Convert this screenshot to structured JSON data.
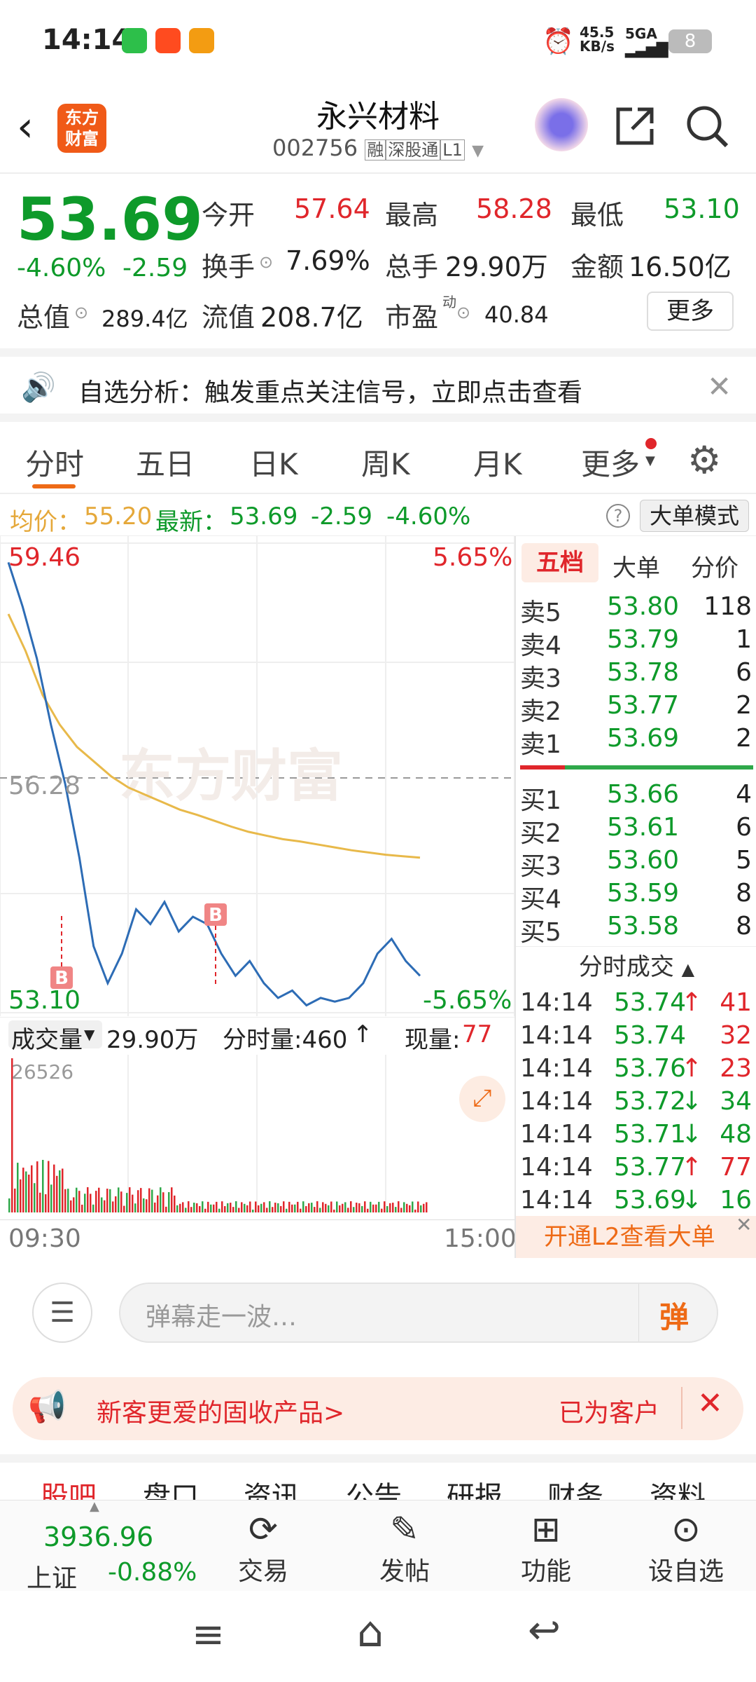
{
  "status_bar": {
    "time": "14:14",
    "net_speed_value": "45.5",
    "net_speed_unit": "KB/s",
    "network": "5GA",
    "battery": "8"
  },
  "header": {
    "title": "永兴材料",
    "code": "002756",
    "tags": [
      "融",
      "深股通",
      "L1"
    ],
    "logo_line1": "东方",
    "logo_line2": "财富"
  },
  "quote": {
    "price": "53.69",
    "change_pct": "-4.60%",
    "change": "-2.59",
    "open_label": "今开",
    "open": "57.64",
    "high_label": "最高",
    "high": "58.28",
    "low_label": "最低",
    "low": "53.10",
    "turnover_label": "换手",
    "turnover": "7.69%",
    "volume_label": "总手",
    "volume": "29.90万",
    "amount_label": "金额",
    "amount": "16.50亿",
    "mktcap_label": "总值",
    "mktcap": "289.4亿",
    "float_label": "流值",
    "float": "208.7亿",
    "pe_label": "市盈",
    "pe_sup": "动",
    "pe": "40.84",
    "more_label": "更多"
  },
  "banner": {
    "text": "自选分析：触发重点关注信号，立即点击查看"
  },
  "tabs": [
    "分时",
    "五日",
    "日K",
    "周K",
    "月K",
    "更多"
  ],
  "avg_line": {
    "avg_label": "均价：",
    "avg": "55.20",
    "last_label": "最新：",
    "last": "53.69",
    "change": "-2.59",
    "pct": "-4.60%",
    "mode_label": "大单模式"
  },
  "chart": {
    "y_max": "59.46",
    "y_max_pct": "5.65%",
    "y_mid": "56.28",
    "y_min": "53.10",
    "y_min_pct": "-5.65%",
    "watermark": "东方财富",
    "marker": "B",
    "vol_label": "成交量",
    "vol_total": "29.90万",
    "minute_vol_label": "分时量:460",
    "minute_vol_arrow": "↑",
    "current_vol_label": "现量:",
    "current_vol": "77",
    "vol_max": "26526",
    "t_start": "09:30",
    "t_end": "15:00"
  },
  "chart_data": {
    "type": "line",
    "title": "",
    "ylim": [
      53.1,
      59.46
    ],
    "x": [
      "09:30",
      "15:00"
    ],
    "series": [
      {
        "values": [
          59.2,
          58.6,
          57.9,
          57.0,
          56.2,
          55.2,
          54.0,
          53.5,
          53.9,
          54.5,
          54.3,
          54.6,
          54.2,
          54.4,
          54.3,
          53.9,
          53.6,
          53.8,
          53.5,
          53.3,
          53.4,
          53.2,
          53.3,
          53.25,
          53.3,
          53.5,
          53.9,
          54.1,
          53.8,
          53.6
        ]
      },
      {
        "values": [
          58.5,
          58.0,
          57.4,
          57.0,
          56.7,
          56.5,
          56.3,
          56.15,
          56.05,
          55.95,
          55.85,
          55.78,
          55.7,
          55.62,
          55.55,
          55.5,
          55.45,
          55.42,
          55.38,
          55.34,
          55.3,
          55.27,
          55.24,
          55.22,
          55.2
        ]
      }
    ]
  },
  "orderbook": {
    "tabs": [
      "五档",
      "大单",
      "分价"
    ],
    "asks": [
      {
        "label": "卖5",
        "price": "53.80",
        "vol": "118"
      },
      {
        "label": "卖4",
        "price": "53.79",
        "vol": "1"
      },
      {
        "label": "卖3",
        "price": "53.78",
        "vol": "6"
      },
      {
        "label": "卖2",
        "price": "53.77",
        "vol": "2"
      },
      {
        "label": "卖1",
        "price": "53.69",
        "vol": "2"
      }
    ],
    "bids": [
      {
        "label": "买1",
        "price": "53.66",
        "vol": "4"
      },
      {
        "label": "买2",
        "price": "53.61",
        "vol": "6"
      },
      {
        "label": "买3",
        "price": "53.60",
        "vol": "5"
      },
      {
        "label": "买4",
        "price": "53.59",
        "vol": "8"
      },
      {
        "label": "买5",
        "price": "53.58",
        "vol": "8"
      }
    ],
    "trades_title": "分时成交",
    "trades": [
      {
        "time": "14:14",
        "price": "53.74",
        "arrow": "↑",
        "vol": "41",
        "dir": "up"
      },
      {
        "time": "14:14",
        "price": "53.74",
        "arrow": "",
        "vol": "32",
        "dir": "up"
      },
      {
        "time": "14:14",
        "price": "53.76",
        "arrow": "↑",
        "vol": "23",
        "dir": "up"
      },
      {
        "time": "14:14",
        "price": "53.72",
        "arrow": "↓",
        "vol": "34",
        "dir": "down"
      },
      {
        "time": "14:14",
        "price": "53.71",
        "arrow": "↓",
        "vol": "48",
        "dir": "down"
      },
      {
        "time": "14:14",
        "price": "53.77",
        "arrow": "↑",
        "vol": "77",
        "dir": "up"
      },
      {
        "time": "14:14",
        "price": "53.69",
        "arrow": "↓",
        "vol": "16",
        "dir": "down"
      }
    ],
    "l2_label": "开通L2查看大单"
  },
  "danmu": {
    "placeholder": "弹幕走一波…",
    "button": "弹"
  },
  "promo": {
    "text": "新客更爱的固收产品>",
    "right": "已为客户"
  },
  "bottom_tabs": [
    "股吧",
    "盘口",
    "资讯",
    "公告",
    "研报",
    "财务",
    "资料"
  ],
  "bottom_nav": {
    "index_value": "3936.96",
    "index_name": "上证",
    "index_pct": "-0.88%",
    "items": [
      "交易",
      "发帖",
      "功能",
      "设自选"
    ]
  },
  "colors": {
    "up": "#e0262b",
    "down": "#0e9a2a",
    "accent": "#ee6a16",
    "price_line": "#2d6cb5",
    "avg_line": "#e8b94a"
  }
}
